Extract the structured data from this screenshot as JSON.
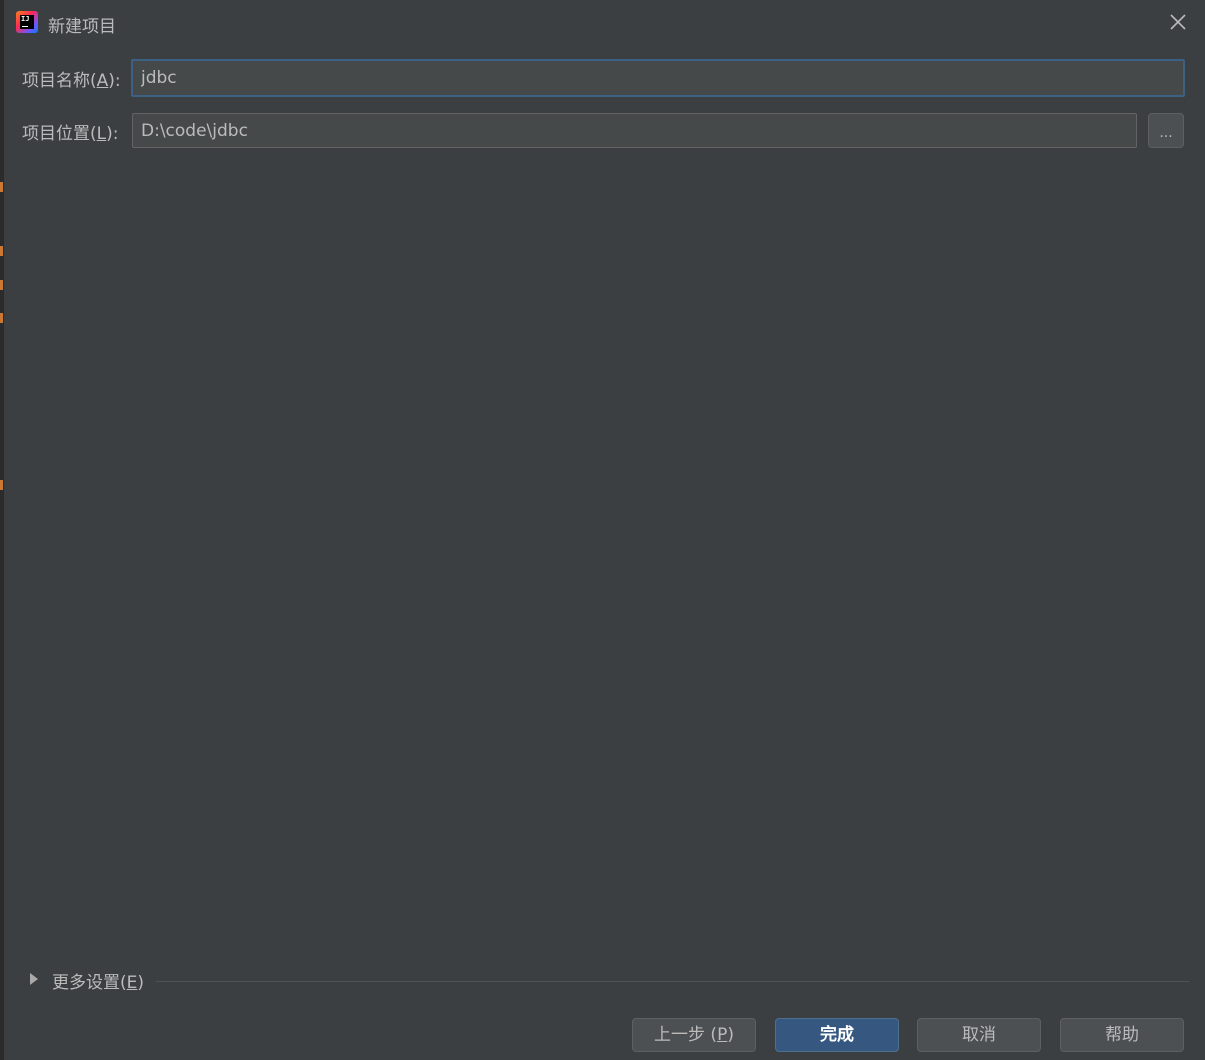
{
  "window": {
    "title": "新建项目"
  },
  "form": {
    "name_label": "项目名称(",
    "name_mnemonic": "A",
    "name_label_end": "):",
    "name_value": "jdbc",
    "location_label": "项目位置(",
    "location_mnemonic": "L",
    "location_label_end": "):",
    "location_value": "D:\\code\\jdbc",
    "browse_label": "..."
  },
  "more_settings": {
    "label": "更多设置(",
    "mnemonic": "E",
    "label_end": ")"
  },
  "buttons": {
    "previous": {
      "label": "上一步 (",
      "mnemonic": "P",
      "label_end": ")"
    },
    "finish": "完成",
    "cancel": "取消",
    "help": "帮助"
  },
  "colors": {
    "background": "#3c3f41",
    "input_background": "#45494a",
    "focus_border": "#3d6185",
    "primary_button": "#365880",
    "text": "#bbbbbb"
  },
  "icons": {
    "app": "intellij-idea-icon",
    "close": "close-icon",
    "expand": "triangle-right-icon"
  }
}
